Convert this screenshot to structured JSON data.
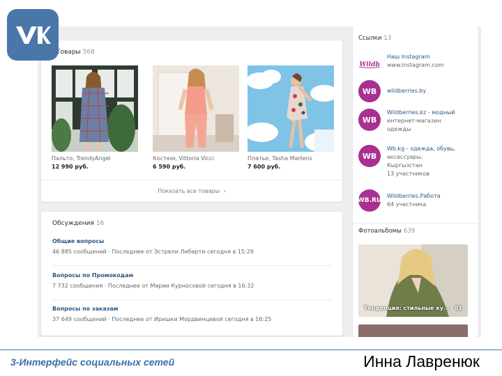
{
  "logo": {
    "icon": "vk-logo-icon",
    "color": "#4a76a8"
  },
  "goods": {
    "title": "Товары",
    "count": "568",
    "items": [
      {
        "name": "Пальто, TrendyAngel",
        "price": "12 990 руб."
      },
      {
        "name": "Костюм, Vittoria Vicci",
        "price": "6 590 руб."
      },
      {
        "name": "Платье, Tasha Martens",
        "price": "7 600 руб."
      }
    ],
    "show_all": "Показать все товары"
  },
  "discussions": {
    "title": "Обсуждения",
    "count": "16",
    "topics": [
      {
        "title": "Общие вопросы",
        "messages": "46 885 сообщений",
        "last": "Последнее от Эстрели Либерти сегодня в 15:29"
      },
      {
        "title": "Вопросы по Промокодам",
        "messages": "7 732 сообщения",
        "last": "Последнее от Марии Курносовой сегодня в 16:32"
      },
      {
        "title": "Вопросы по заказам",
        "messages": "37 649 сообщений",
        "last": "Последнее от Иришки Мордвинцевой сегодня в 16:25"
      }
    ]
  },
  "links": {
    "title": "Ссылки",
    "count": "13",
    "items": [
      {
        "avatar": "instagram",
        "title": "Наш Instagram",
        "sub1": "www.instagram.com",
        "sub2": ""
      },
      {
        "avatar": "WB",
        "title": "wildberries.by",
        "sub1": "",
        "sub2": ""
      },
      {
        "avatar": "WB",
        "title": "Wildberries.kz - модный",
        "sub1": "интернет-магазин",
        "sub2": "одежды"
      },
      {
        "avatar": "WB",
        "title": "Wb.kg - одежда, обувь,",
        "sub1": "аксессуары,",
        "sub2": "Кыргызстан",
        "sub3": "13 участников"
      },
      {
        "avatar": "WB.RU",
        "title": "Wildberries.Работа",
        "sub1": "64 участника",
        "sub2": ""
      }
    ]
  },
  "albums": {
    "title": "Фотоальбомы",
    "count": "639",
    "first_caption": "Тенденция: стильные ку...",
    "first_count": "81"
  },
  "footer": {
    "course": "3-Интерфейс социальных сетей",
    "author": "Инна Лавренюк"
  }
}
